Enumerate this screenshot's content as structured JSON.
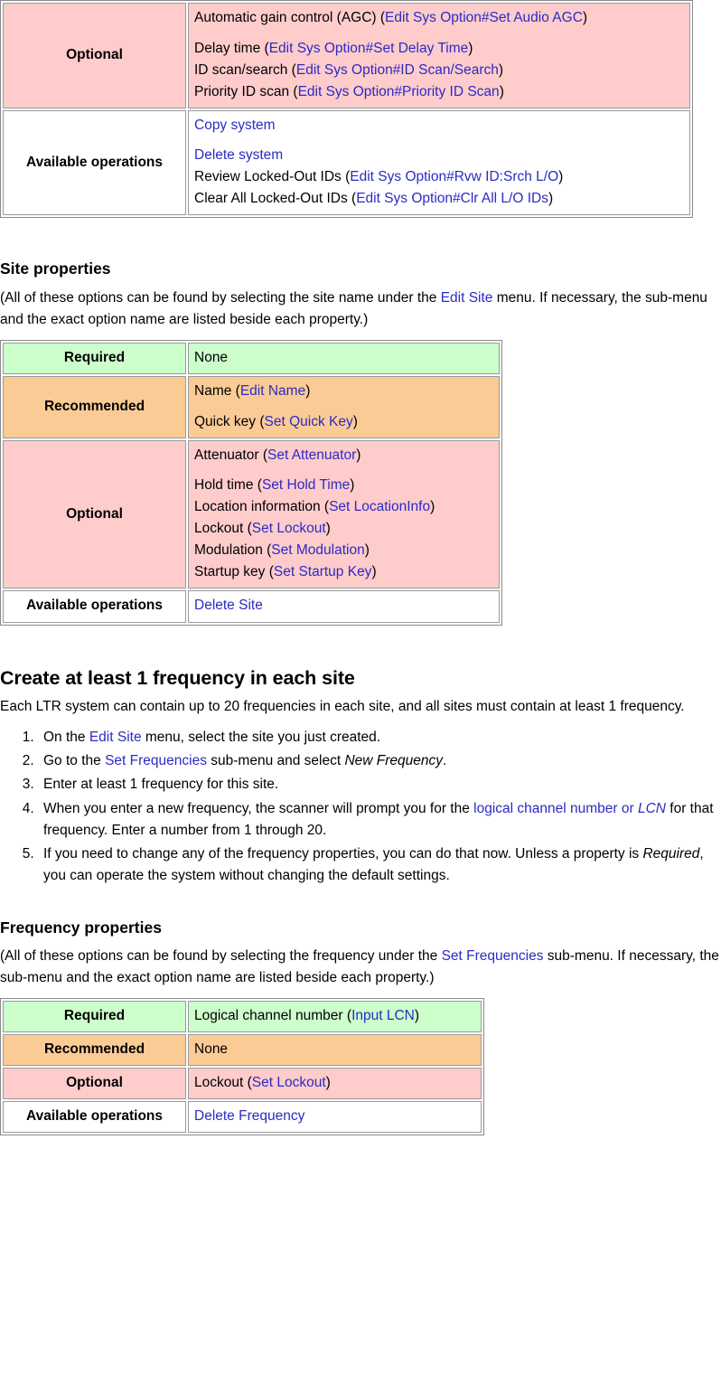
{
  "system_table": {
    "name": "system-properties-table-continued",
    "rows": [
      {
        "label": "Optional",
        "label_color": "#ffcccc",
        "value_color": "#ffcccc",
        "lines": [
          {
            "text_before": "Automatic gain control (AGC) (",
            "link": "Edit Sys Option#Set Audio AGC",
            "text_after": ")",
            "spaced": true
          },
          {
            "text_before": "Delay time (",
            "link": "Edit Sys Option#Set Delay Time",
            "text_after": ")",
            "spaced": true
          },
          {
            "text_before": "ID scan/search (",
            "link": "Edit Sys Option#ID Scan/Search",
            "text_after": ")",
            "spaced": false
          },
          {
            "text_before": "Priority ID scan (",
            "link": "Edit Sys Option#Priority ID Scan",
            "text_after": ")",
            "spaced": false
          }
        ]
      },
      {
        "label": "Available operations",
        "label_color": "#ffffff",
        "value_color": "#ffffff",
        "lines": [
          {
            "text_before": "",
            "link": "Copy system",
            "text_after": "",
            "spaced": true
          },
          {
            "text_before": "",
            "link": "Delete system",
            "text_after": "",
            "spaced": true
          },
          {
            "text_before": "Review Locked-Out IDs (",
            "link": "Edit Sys Option#Rvw ID:Srch L/O",
            "text_after": ")",
            "spaced": false
          },
          {
            "text_before": "Clear All Locked-Out IDs (",
            "link": "Edit Sys Option#Clr All L/O IDs",
            "text_after": ")",
            "spaced": false
          }
        ]
      }
    ]
  },
  "site_section": {
    "heading": "Site properties",
    "intro_before": "(All of these options can be found by selecting the site name under the ",
    "intro_link": "Edit Site",
    "intro_after": " menu. If necessary, the sub-menu and the exact option name are listed beside each property.)"
  },
  "site_table": {
    "name": "site-properties-table",
    "rows": [
      {
        "label": "Required",
        "color": "#ccffcc",
        "lines": [
          {
            "text_before": "None",
            "link": "",
            "text_after": "",
            "spaced": true
          }
        ]
      },
      {
        "label": "Recommended",
        "color": "#fbcb96",
        "lines": [
          {
            "text_before": "Name (",
            "link": "Edit Name",
            "text_after": ")",
            "spaced": true
          },
          {
            "text_before": "Quick key (",
            "link": "Set Quick Key",
            "text_after": ")",
            "spaced": true
          }
        ]
      },
      {
        "label": "Optional",
        "color": "#ffcccc",
        "lines": [
          {
            "text_before": "Attenuator (",
            "link": "Set Attenuator",
            "text_after": ")",
            "spaced": true
          },
          {
            "text_before": "Hold time (",
            "link": "Set Hold Time",
            "text_after": ")",
            "spaced": true
          },
          {
            "text_before": "Location information (",
            "link": "Set LocationInfo",
            "text_after": ")",
            "spaced": false
          },
          {
            "text_before": "Lockout (",
            "link": "Set Lockout",
            "text_after": ")",
            "spaced": false
          },
          {
            "text_before": "Modulation (",
            "link": "Set Modulation",
            "text_after": ")",
            "spaced": false
          },
          {
            "text_before": "Startup key (",
            "link": "Set Startup Key",
            "text_after": ")",
            "spaced": false
          }
        ]
      },
      {
        "label": "Available operations",
        "color": "#ffffff",
        "lines": [
          {
            "text_before": "",
            "link": "Delete Site",
            "text_after": "",
            "spaced": true
          }
        ]
      }
    ]
  },
  "create_section": {
    "heading": "Create at least 1 frequency in each site",
    "intro": "Each LTR system can contain up to 20 frequencies in each site, and all sites must contain at least 1 frequency.",
    "steps": [
      {
        "id": 1,
        "parts": [
          {
            "t": "On the ",
            "k": "plain"
          },
          {
            "t": "Edit Site",
            "k": "link"
          },
          {
            "t": " menu, select the site you just created.",
            "k": "plain"
          }
        ]
      },
      {
        "id": 2,
        "parts": [
          {
            "t": "Go to the ",
            "k": "plain"
          },
          {
            "t": "Set Frequencies",
            "k": "link"
          },
          {
            "t": " sub-menu and select ",
            "k": "plain"
          },
          {
            "t": "New Frequency",
            "k": "italic"
          },
          {
            "t": ".",
            "k": "plain"
          }
        ]
      },
      {
        "id": 3,
        "parts": [
          {
            "t": "Enter at least 1 frequency for this site.",
            "k": "plain"
          }
        ]
      },
      {
        "id": 4,
        "parts": [
          {
            "t": "When you enter a new frequency, the scanner will prompt you for the ",
            "k": "plain"
          },
          {
            "t": "logical channel number or ",
            "k": "link"
          },
          {
            "t": "LCN",
            "k": "link-italic"
          },
          {
            "t": " for that frequency. Enter a number from 1 through 20.",
            "k": "plain"
          }
        ]
      },
      {
        "id": 5,
        "parts": [
          {
            "t": "If you need to change any of the frequency properties, you can do that now. Unless a property is ",
            "k": "plain"
          },
          {
            "t": "Required",
            "k": "italic"
          },
          {
            "t": ", you can operate the system without changing the default settings.",
            "k": "plain"
          }
        ]
      }
    ]
  },
  "freq_section": {
    "heading": "Frequency properties",
    "intro_before": "(All of these options can be found by selecting the frequency under the ",
    "intro_link": "Set Frequencies",
    "intro_after": " sub-menu. If necessary, the sub-menu and the exact option name are listed beside each property.)"
  },
  "freq_table": {
    "name": "frequency-properties-table",
    "rows": [
      {
        "label": "Required",
        "color": "#ccffcc",
        "lines": [
          {
            "text_before": "Logical channel number (",
            "link": "Input LCN",
            "text_after": ")",
            "spaced": true
          }
        ]
      },
      {
        "label": "Recommended",
        "color": "#fbcb96",
        "lines": [
          {
            "text_before": "None",
            "link": "",
            "text_after": "",
            "spaced": true
          }
        ]
      },
      {
        "label": "Optional",
        "color": "#ffcccc",
        "lines": [
          {
            "text_before": "Lockout (",
            "link": "Set Lockout",
            "text_after": ")",
            "spaced": true
          }
        ]
      },
      {
        "label": "Available operations",
        "color": "#ffffff",
        "lines": [
          {
            "text_before": "",
            "link": "Delete Frequency",
            "text_after": "",
            "spaced": true
          }
        ]
      }
    ]
  },
  "colors": {
    "link": "#2b2bc4",
    "required": "#ccffcc",
    "recommended": "#fbcb96",
    "optional": "#ffcccc",
    "operations": "#ffffff",
    "table_border": "#8a8a8a",
    "cell_border": "#9a9a9a"
  }
}
